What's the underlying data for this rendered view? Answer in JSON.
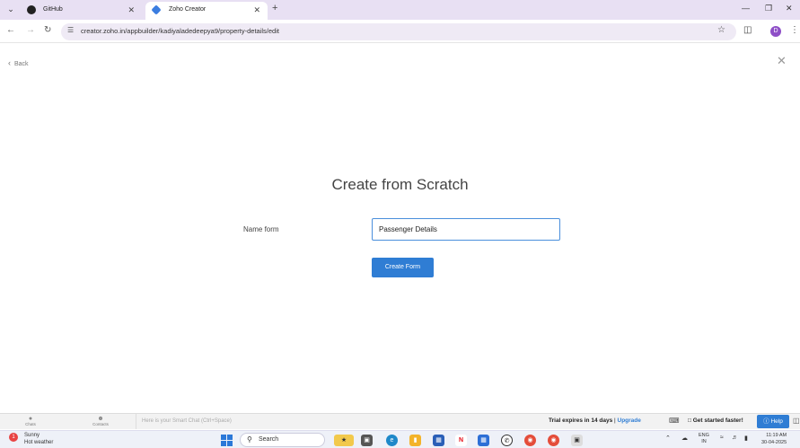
{
  "browser": {
    "tabs": [
      {
        "label": "GitHub",
        "favicon": "github-icon",
        "active": false
      },
      {
        "label": "Zoho Creator",
        "favicon": "zoho-creator-icon",
        "active": true
      }
    ],
    "url": "creator.zoho.in/appbuilder/kadiyaladedeepya9/property-details/edit",
    "profile_initial": "D"
  },
  "page": {
    "back_label": "Back",
    "title": "Create from Scratch",
    "name_form_label": "Name form",
    "name_form_value": "Passenger Details",
    "create_button": "Create Form"
  },
  "zoho_bar": {
    "chats_label": "Chats",
    "contacts_label": "Contacts",
    "smart_chat_placeholder": "Here is your Smart Chat (Ctrl+Space)",
    "trial_text": "Trial expires in 14 days",
    "upgrade_label": "Upgrade",
    "get_started_label": "Get started faster!",
    "help_label": "Help"
  },
  "taskbar": {
    "weather_badge": "1",
    "weather_title": "Sunny",
    "weather_sub": "Hot weather",
    "search_label": "Search",
    "lang_top": "ENG",
    "lang_bottom": "IN",
    "time": "11:19 AM",
    "date": "30-04-2025"
  },
  "colors": {
    "accent": "#2f7dd4",
    "tabstrip_bg": "#e8e0f3"
  }
}
